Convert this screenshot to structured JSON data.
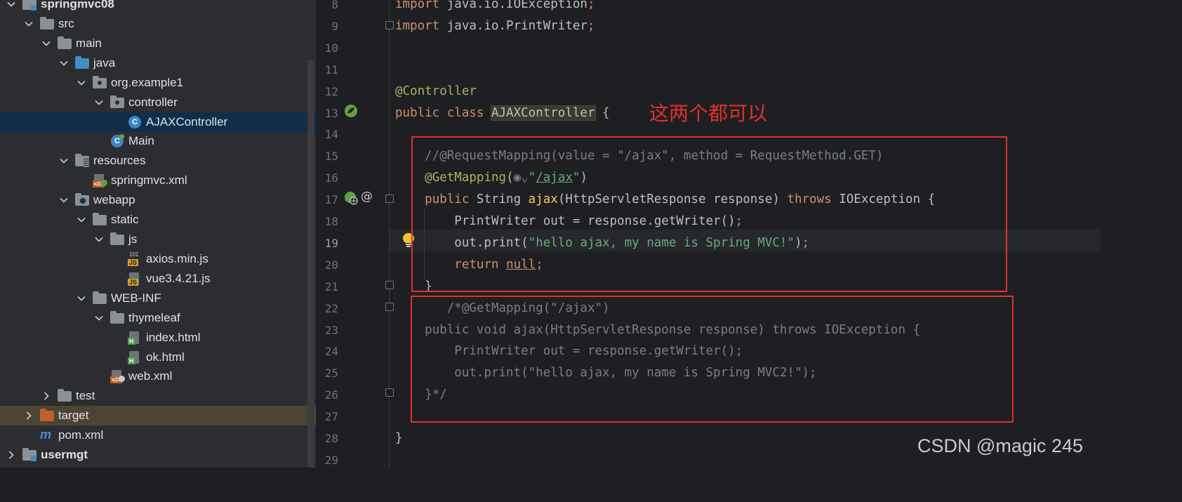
{
  "project_tree": {
    "items": [
      {
        "label": "springmvc08",
        "depth": 0,
        "expanded": true,
        "icon": "module-folder-icon",
        "bold": true
      },
      {
        "label": "src",
        "depth": 1,
        "expanded": true,
        "icon": "folder-icon"
      },
      {
        "label": "main",
        "depth": 2,
        "expanded": true,
        "icon": "folder-icon"
      },
      {
        "label": "java",
        "depth": 3,
        "expanded": true,
        "icon": "source-folder-icon"
      },
      {
        "label": "org.example1",
        "depth": 4,
        "expanded": true,
        "icon": "package-icon"
      },
      {
        "label": "controller",
        "depth": 5,
        "expanded": true,
        "icon": "package-icon"
      },
      {
        "label": "AJAXController",
        "depth": 6,
        "icon": "class-icon",
        "selected": true
      },
      {
        "label": "Main",
        "depth": 5,
        "icon": "main-class-icon"
      },
      {
        "label": "resources",
        "depth": 3,
        "expanded": true,
        "icon": "resources-folder-icon"
      },
      {
        "label": "springmvc.xml",
        "depth": 4,
        "icon": "spring-xml-icon"
      },
      {
        "label": "webapp",
        "depth": 3,
        "expanded": true,
        "icon": "web-folder-icon"
      },
      {
        "label": "static",
        "depth": 4,
        "expanded": true,
        "icon": "folder-icon"
      },
      {
        "label": "js",
        "depth": 5,
        "expanded": true,
        "icon": "folder-icon"
      },
      {
        "label": "axios.min.js",
        "depth": 6,
        "icon": "js-min-file-icon"
      },
      {
        "label": "vue3.4.21.js",
        "depth": 6,
        "icon": "js-file-icon"
      },
      {
        "label": "WEB-INF",
        "depth": 4,
        "expanded": true,
        "icon": "folder-icon"
      },
      {
        "label": "thymeleaf",
        "depth": 5,
        "expanded": true,
        "icon": "folder-icon"
      },
      {
        "label": "index.html",
        "depth": 6,
        "icon": "html-file-icon"
      },
      {
        "label": "ok.html",
        "depth": 6,
        "icon": "html-file-icon"
      },
      {
        "label": "web.xml",
        "depth": 5,
        "icon": "web-xml-icon"
      },
      {
        "label": "test",
        "depth": 2,
        "expanded": false,
        "icon": "folder-icon"
      },
      {
        "label": "target",
        "depth": 1,
        "expanded": false,
        "icon": "excluded-folder-icon",
        "hover": true
      },
      {
        "label": "pom.xml",
        "depth": 1,
        "icon": "maven-icon"
      },
      {
        "label": "usermgt",
        "depth": 0,
        "expanded": false,
        "icon": "module-folder-icon",
        "bold": true
      }
    ]
  },
  "editor": {
    "current_line": "19",
    "lines": [
      {
        "n": "8",
        "html": "<span class='kw'>import</span> java.io.IOException<span class='kw'>;</span>"
      },
      {
        "n": "9",
        "html": "<span class='kw'>import</span> java.io.PrintWriter<span class='kw'>;</span>"
      },
      {
        "n": "10",
        "html": ""
      },
      {
        "n": "11",
        "html": ""
      },
      {
        "n": "12",
        "html": "<span class='ann'>@Controller</span>"
      },
      {
        "n": "13",
        "html": "<span class='kw'>public class</span> <span class='cls-hl'>AJAXController</span> {"
      },
      {
        "n": "14",
        "html": ""
      },
      {
        "n": "15",
        "html": "    <span class='cmt'>//@RequestMapping(value = \"/ajax\", method = RequestMethod.GET)</span>"
      },
      {
        "n": "16",
        "html": "    <span class='ann'>@GetMapping</span>(<span class='cmt'>&#9673;&#8964;</span><span class='str'>\"<span class='u'>/ajax</span>\"</span>)"
      },
      {
        "n": "17",
        "html": "    <span class='kw'>public</span> String <span class='fnd'>ajax</span>(HttpServletResponse response) <span class='kw'>throws</span> IOException {"
      },
      {
        "n": "18",
        "html": "        PrintWriter out = response.getWriter()<span class='kw'>;</span>"
      },
      {
        "n": "19",
        "html": "        out.print(<span class='str'>\"hello ajax, my name is Spring MVC!\"</span>)<span class='kw'>;</span>"
      },
      {
        "n": "20",
        "html": "        <span class='kw'>return</span> <span class='kw u'>null</span><span class='kw'>;</span>"
      },
      {
        "n": "21",
        "html": "    }"
      },
      {
        "n": "22",
        "html": "       <span class='cmt'>/*@GetMapping(\"/ajax\")</span>"
      },
      {
        "n": "23",
        "html": "    <span class='cmt'>public void ajax(HttpServletResponse response) throws IOException {</span>"
      },
      {
        "n": "24",
        "html": "        <span class='cmt'>PrintWriter out = response.getWriter();</span>"
      },
      {
        "n": "25",
        "html": "        <span class='cmt'>out.print(\"hello ajax, my name is Spring MVC2!\");</span>"
      },
      {
        "n": "26",
        "html": "    <span class='cmt'>}*/</span>"
      },
      {
        "n": "27",
        "html": ""
      },
      {
        "n": "28",
        "html": "}"
      },
      {
        "n": "29",
        "html": ""
      }
    ]
  },
  "annotation_note": "这两个都可以",
  "watermark": "CSDN @magic 245",
  "colors": {
    "annotation_red": "#e0312b",
    "selection": "#0f2e4a",
    "keyword": "#cf8e6d",
    "string": "#6aab73"
  }
}
